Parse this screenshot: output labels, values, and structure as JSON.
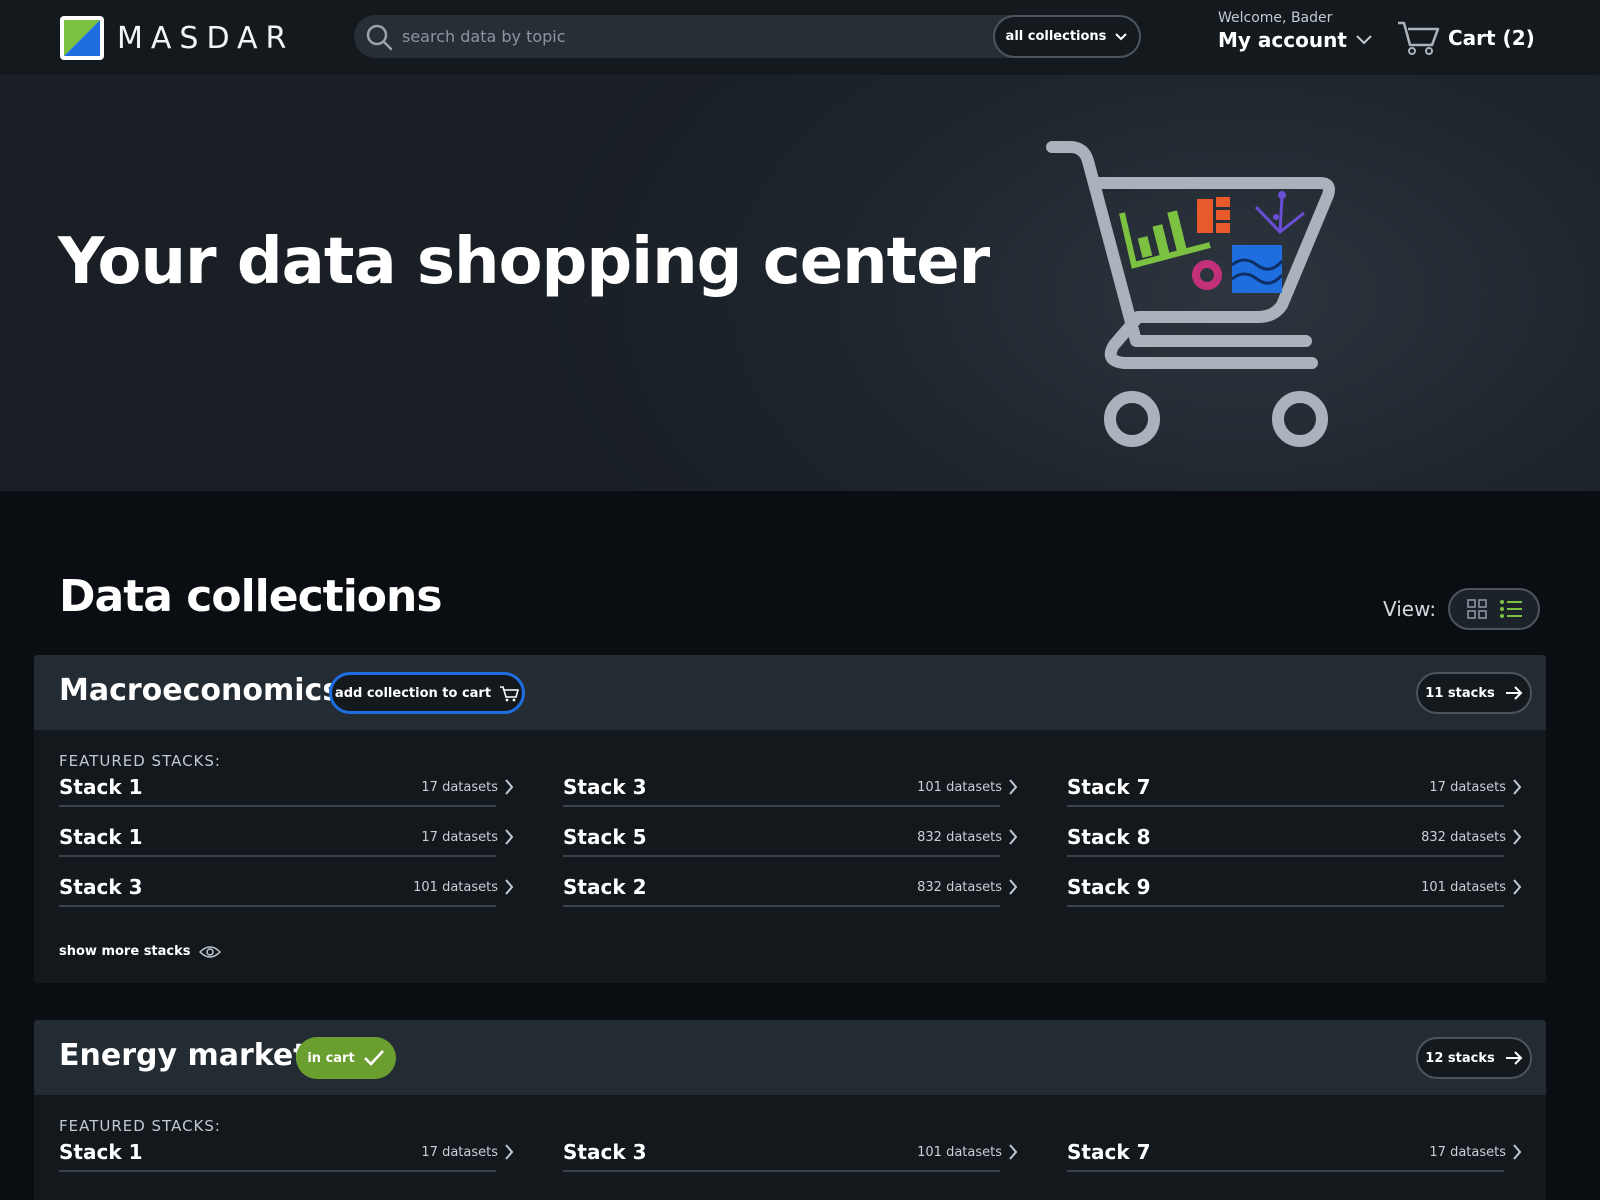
{
  "brand": {
    "name": "MASDAR",
    "colors": {
      "green": "#7cc142",
      "blue": "#1e6ee0"
    }
  },
  "header": {
    "search_placeholder": "search data by topic",
    "collections_dropdown": "all collections",
    "welcome": "Welcome, Bader",
    "account_label": "My account",
    "cart_label": "Cart (2)"
  },
  "hero": {
    "title": "Your data shopping center"
  },
  "collections_section": {
    "title": "Data collections",
    "view_label": "View:",
    "view_mode": "list"
  },
  "collections": [
    {
      "title": "Macroeconomics",
      "action_label": "add collection to cart",
      "stacks_label": "11 stacks",
      "featured_label": "FEATURED STACKS:",
      "stacks": [
        {
          "name": "Stack 1",
          "count": "17 datasets"
        },
        {
          "name": "Stack 1",
          "count": "17 datasets"
        },
        {
          "name": "Stack 3",
          "count": "101 datasets"
        },
        {
          "name": "Stack 3",
          "count": "101 datasets"
        },
        {
          "name": "Stack 5",
          "count": "832 datasets"
        },
        {
          "name": "Stack 2",
          "count": "832 datasets"
        },
        {
          "name": "Stack 7",
          "count": "17 datasets"
        },
        {
          "name": "Stack 8",
          "count": "832 datasets"
        },
        {
          "name": "Stack 9",
          "count": "101 datasets"
        }
      ],
      "show_more": "show more stacks"
    },
    {
      "title": "Energy market",
      "action_label": "in cart",
      "stacks_label": "12 stacks",
      "featured_label": "FEATURED STACKS:",
      "stacks": [
        {
          "name": "Stack 1",
          "count": "17 datasets"
        },
        {
          "name": "Stack 3",
          "count": "101 datasets"
        },
        {
          "name": "Stack 7",
          "count": "17 datasets"
        }
      ]
    }
  ]
}
